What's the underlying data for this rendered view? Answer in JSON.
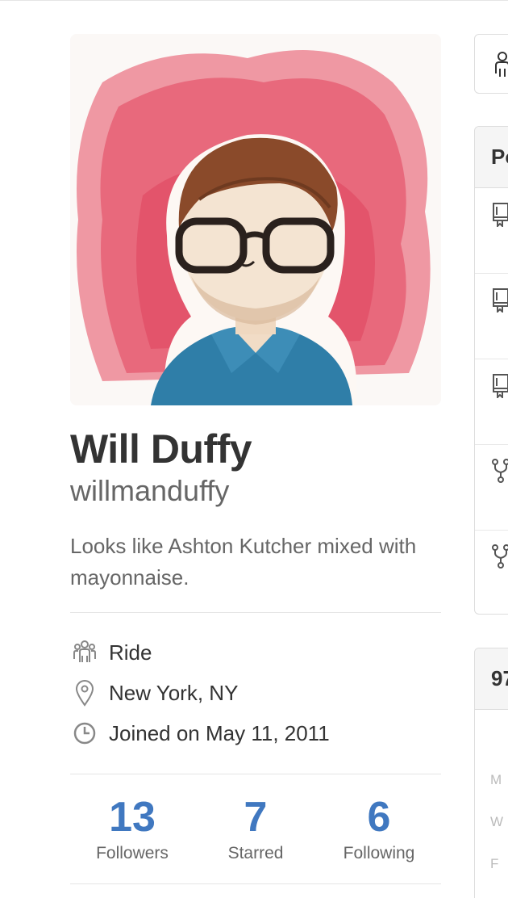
{
  "profile": {
    "full_name": "Will Duffy",
    "username": "willmanduffy",
    "bio": "Looks like Ashton Kutcher mixed with mayonnaise."
  },
  "details": [
    {
      "icon": "organization-icon",
      "text": "Ride"
    },
    {
      "icon": "location-icon",
      "text": "New York, NY"
    },
    {
      "icon": "clock-icon",
      "text": "Joined on May 11, 2011"
    }
  ],
  "stats": [
    {
      "value": "13",
      "label": "Followers"
    },
    {
      "value": "7",
      "label": "Starred"
    },
    {
      "value": "6",
      "label": "Following"
    }
  ],
  "right_panels": {
    "popular_header": "Po",
    "contributions_header": "97",
    "day_labels": [
      "M",
      "W",
      "F"
    ]
  },
  "colors": {
    "accent": "#4078c0",
    "text": "#333333",
    "muted": "#666666",
    "border": "#e5e5e5"
  }
}
